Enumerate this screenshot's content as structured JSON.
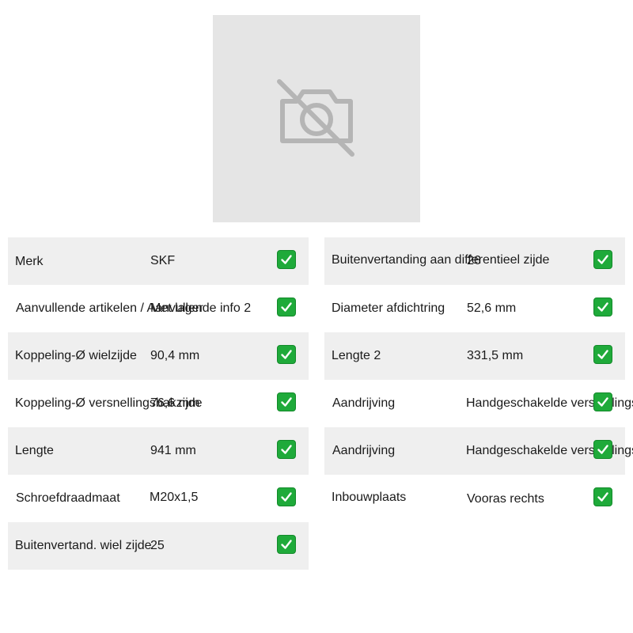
{
  "image": {
    "icon": "camera-off-icon"
  },
  "colors": {
    "check": "#1faa3a",
    "row_shade": "#efefef"
  },
  "left": [
    {
      "label": "Merk",
      "value": "SKF"
    },
    {
      "label": "Aanvullende artikelen / Aanvullende info 2",
      "value": "Met lager"
    },
    {
      "label": "Koppeling-Ø wielzijde",
      "value": "90,4 mm"
    },
    {
      "label": "Koppeling-Ø versnellingsbakzijde",
      "value": "76,6 mm"
    },
    {
      "label": "Lengte",
      "value": "941 mm"
    },
    {
      "label": "Schroefdraadmaat",
      "value": "M20x1,5"
    },
    {
      "label": "Buitenvertand. wiel zijde",
      "value": "25"
    }
  ],
  "right": [
    {
      "label": "Buitenvertanding aan differentieel zijde",
      "value": "26"
    },
    {
      "label": "Diameter afdichtring",
      "value": "52,6 mm"
    },
    {
      "label": "Lengte 2",
      "value": "331,5 mm"
    },
    {
      "label": "Aandrijving",
      "value": "Handgeschakelde versnellingsbak"
    },
    {
      "label": "Aandrijving",
      "value": "Handgeschakelde versnellingsbak"
    },
    {
      "label": "Inbouwplaats",
      "value": "Vooras rechts"
    }
  ]
}
